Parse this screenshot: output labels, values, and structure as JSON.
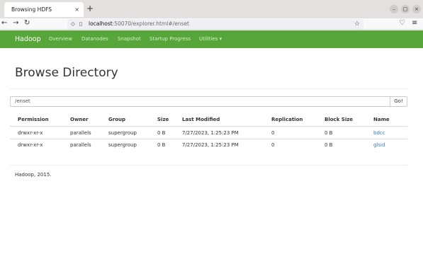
{
  "browser": {
    "tab_title": "Browsing HDFS",
    "tab_close": "×",
    "new_tab": "+",
    "url_host": "localhost",
    "url_rest": ":50070/explorer.html#/enset",
    "win_min": "–",
    "win_max": "□",
    "win_close": "×"
  },
  "navbar": {
    "brand": "Hadoop",
    "links": [
      "Overview",
      "Datanodes",
      "Snapshot",
      "Startup Progress",
      "Utilities ▾"
    ]
  },
  "page": {
    "title": "Browse Directory",
    "path_value": "/enset",
    "go_label": "Go!",
    "footer": "Hadoop, 2015."
  },
  "table": {
    "headers": [
      "Permission",
      "Owner",
      "Group",
      "Size",
      "Last Modified",
      "Replication",
      "Block Size",
      "Name"
    ],
    "rows": [
      [
        "drwxr-xr-x",
        "parallels",
        "supergroup",
        "0 B",
        "7/27/2023, 1:25:23 PM",
        "0",
        "0 B",
        "bdcc"
      ],
      [
        "drwxr-xr-x",
        "parallels",
        "supergroup",
        "0 B",
        "7/27/2023, 1:25:23 PM",
        "0",
        "0 B",
        "glsid"
      ]
    ]
  },
  "colors": {
    "navbar_bg": "#57a63a",
    "link": "#337ab7"
  }
}
